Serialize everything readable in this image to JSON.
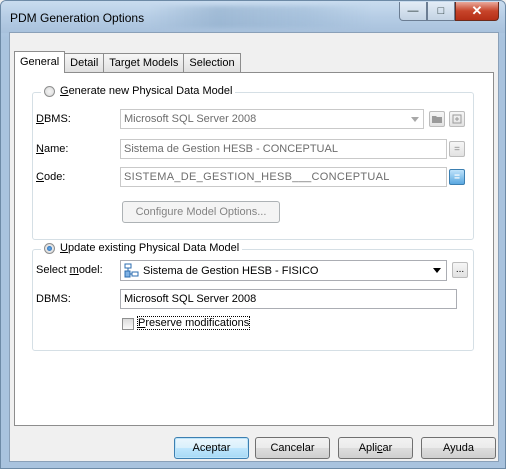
{
  "window": {
    "title": "PDM Generation Options",
    "minimize_glyph": "—",
    "maximize_glyph": "□",
    "close_glyph": "✕"
  },
  "tabs": [
    {
      "label": "General",
      "active": true
    },
    {
      "label": "Detail",
      "active": false
    },
    {
      "label": "Target Models",
      "active": false
    },
    {
      "label": "Selection",
      "active": false
    }
  ],
  "generate_new": {
    "radio_label_key": "G",
    "radio_label_rest": "enerate new Physical Data Model",
    "selected": false,
    "dbms_label_key": "D",
    "dbms_label_rest": "BMS:",
    "dbms_value": "Microsoft SQL Server 2008",
    "name_label_key": "N",
    "name_label_rest": "ame:",
    "name_value": "Sistema de Gestion HESB - CONCEPTUAL",
    "code_label_key": "C",
    "code_label_rest": "ode:",
    "code_value": "SISTEMA_DE_GESTION_HESB___CONCEPTUAL",
    "equal_glyph": "=",
    "configure_button": "Configure Model Options..."
  },
  "update_existing": {
    "radio_label_key": "U",
    "radio_label_rest": "pdate existing Physical Data Model",
    "selected": true,
    "select_model_label_pre": "Select ",
    "select_model_label_key": "m",
    "select_model_label_post": "odel:",
    "select_model_value": "Sistema de Gestion HESB - FISICO",
    "browse_glyph": "...",
    "dbms_label": "DBMS:",
    "dbms_value": "Microsoft SQL Server 2008",
    "preserve_label_key": "P",
    "preserve_label_rest": "reserve modifications",
    "preserve_checked": false
  },
  "buttons": {
    "ok": "Aceptar",
    "cancel": "Cancelar",
    "apply_pre": "Apli",
    "apply_key": "c",
    "apply_post": "ar",
    "help": "Ayuda"
  },
  "colors": {
    "accent": "#3c7fb1",
    "close": "#c7442a"
  }
}
